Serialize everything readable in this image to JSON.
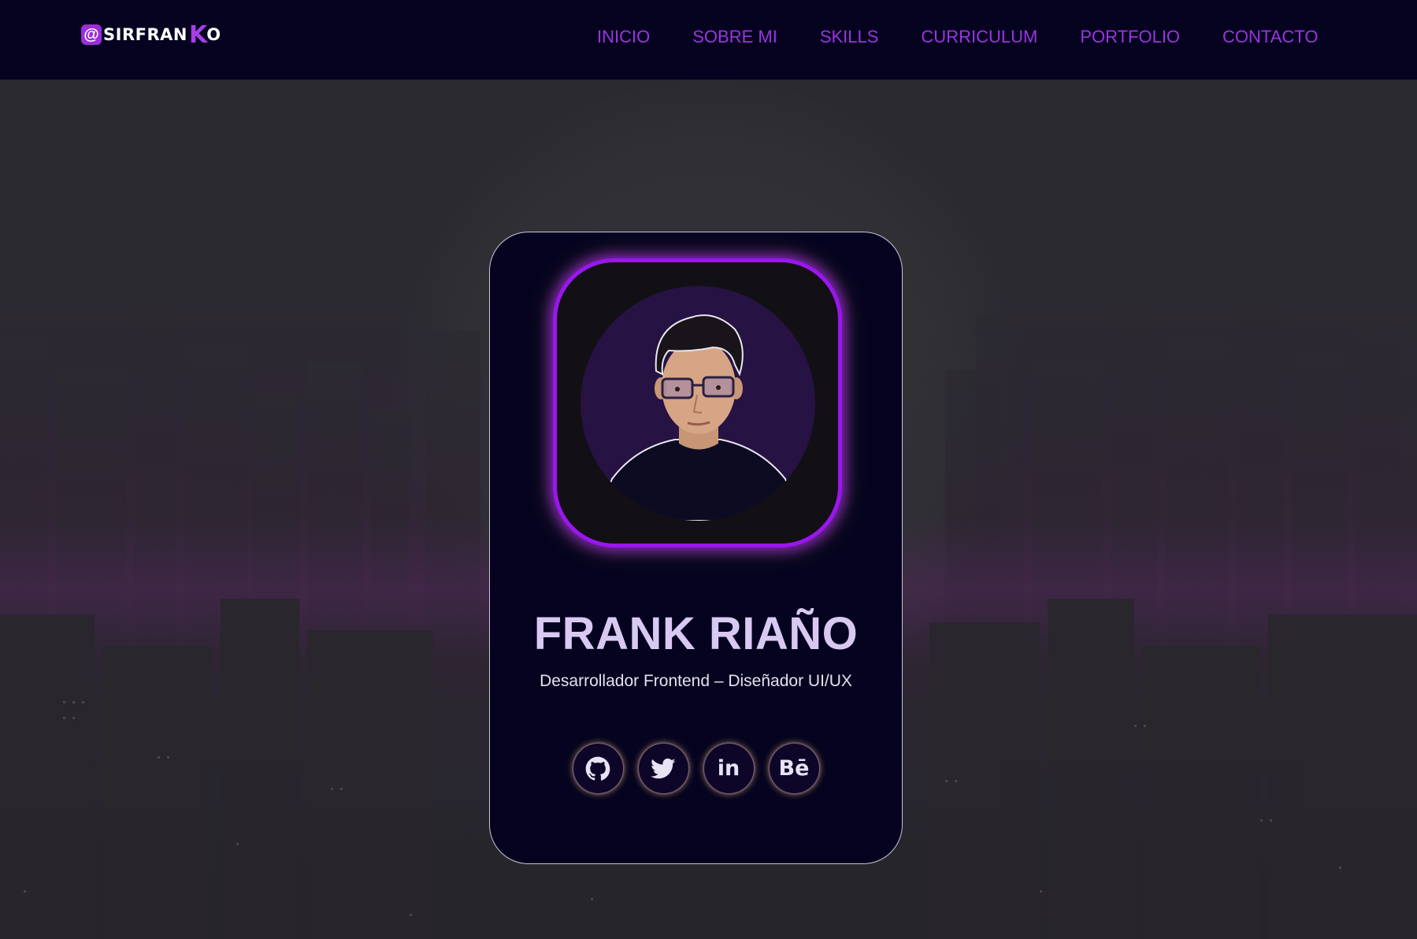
{
  "navbar": {
    "logo": {
      "at": "@",
      "text": "SIRFRAN",
      "k": "K",
      "o": "O"
    },
    "links": [
      {
        "label": "INICIO"
      },
      {
        "label": "SOBRE MI"
      },
      {
        "label": "SKILLS"
      },
      {
        "label": "CURRICULUM"
      },
      {
        "label": "PORTFOLIO"
      },
      {
        "label": "CONTACTO"
      }
    ]
  },
  "profile": {
    "name": "FRANK RIAÑO",
    "role": "Desarrollador Frontend – Diseñador UI/UX",
    "socials": [
      {
        "icon": "github-icon"
      },
      {
        "icon": "twitter-icon"
      },
      {
        "icon": "linkedin-icon",
        "text": "in"
      },
      {
        "icon": "behance-icon",
        "text": "Bē"
      }
    ]
  },
  "colors": {
    "navbar_bg": "#05031f",
    "accent_purple": "#9b35e0",
    "card_bg": "#05031f",
    "name_color": "#d9c9f2"
  }
}
